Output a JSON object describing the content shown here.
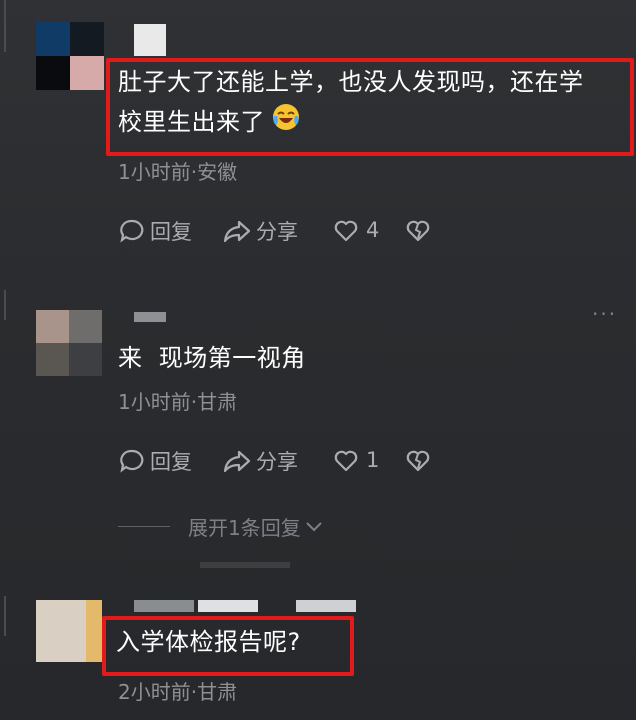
{
  "comments": [
    {
      "text_line1": "肚子大了还能上学，也没人发现吗，还在学",
      "text_line2": "校里生出来了",
      "emoji": "laughing-crying-emoji",
      "meta": "1小时前·安徽",
      "reply_label": "回复",
      "share_label": "分享",
      "like_count": "4"
    },
    {
      "text": "来  现场第一视角",
      "meta": "1小时前·甘肃",
      "reply_label": "回复",
      "share_label": "分享",
      "like_count": "1",
      "expand_replies": "展开1条回复",
      "more": "···"
    },
    {
      "text": "入学体检报告呢?",
      "meta": "2小时前·甘肃"
    }
  ],
  "colors": {
    "highlight": "#e11b1b",
    "background": "#2c2e31",
    "meta_text": "#8d9095"
  }
}
